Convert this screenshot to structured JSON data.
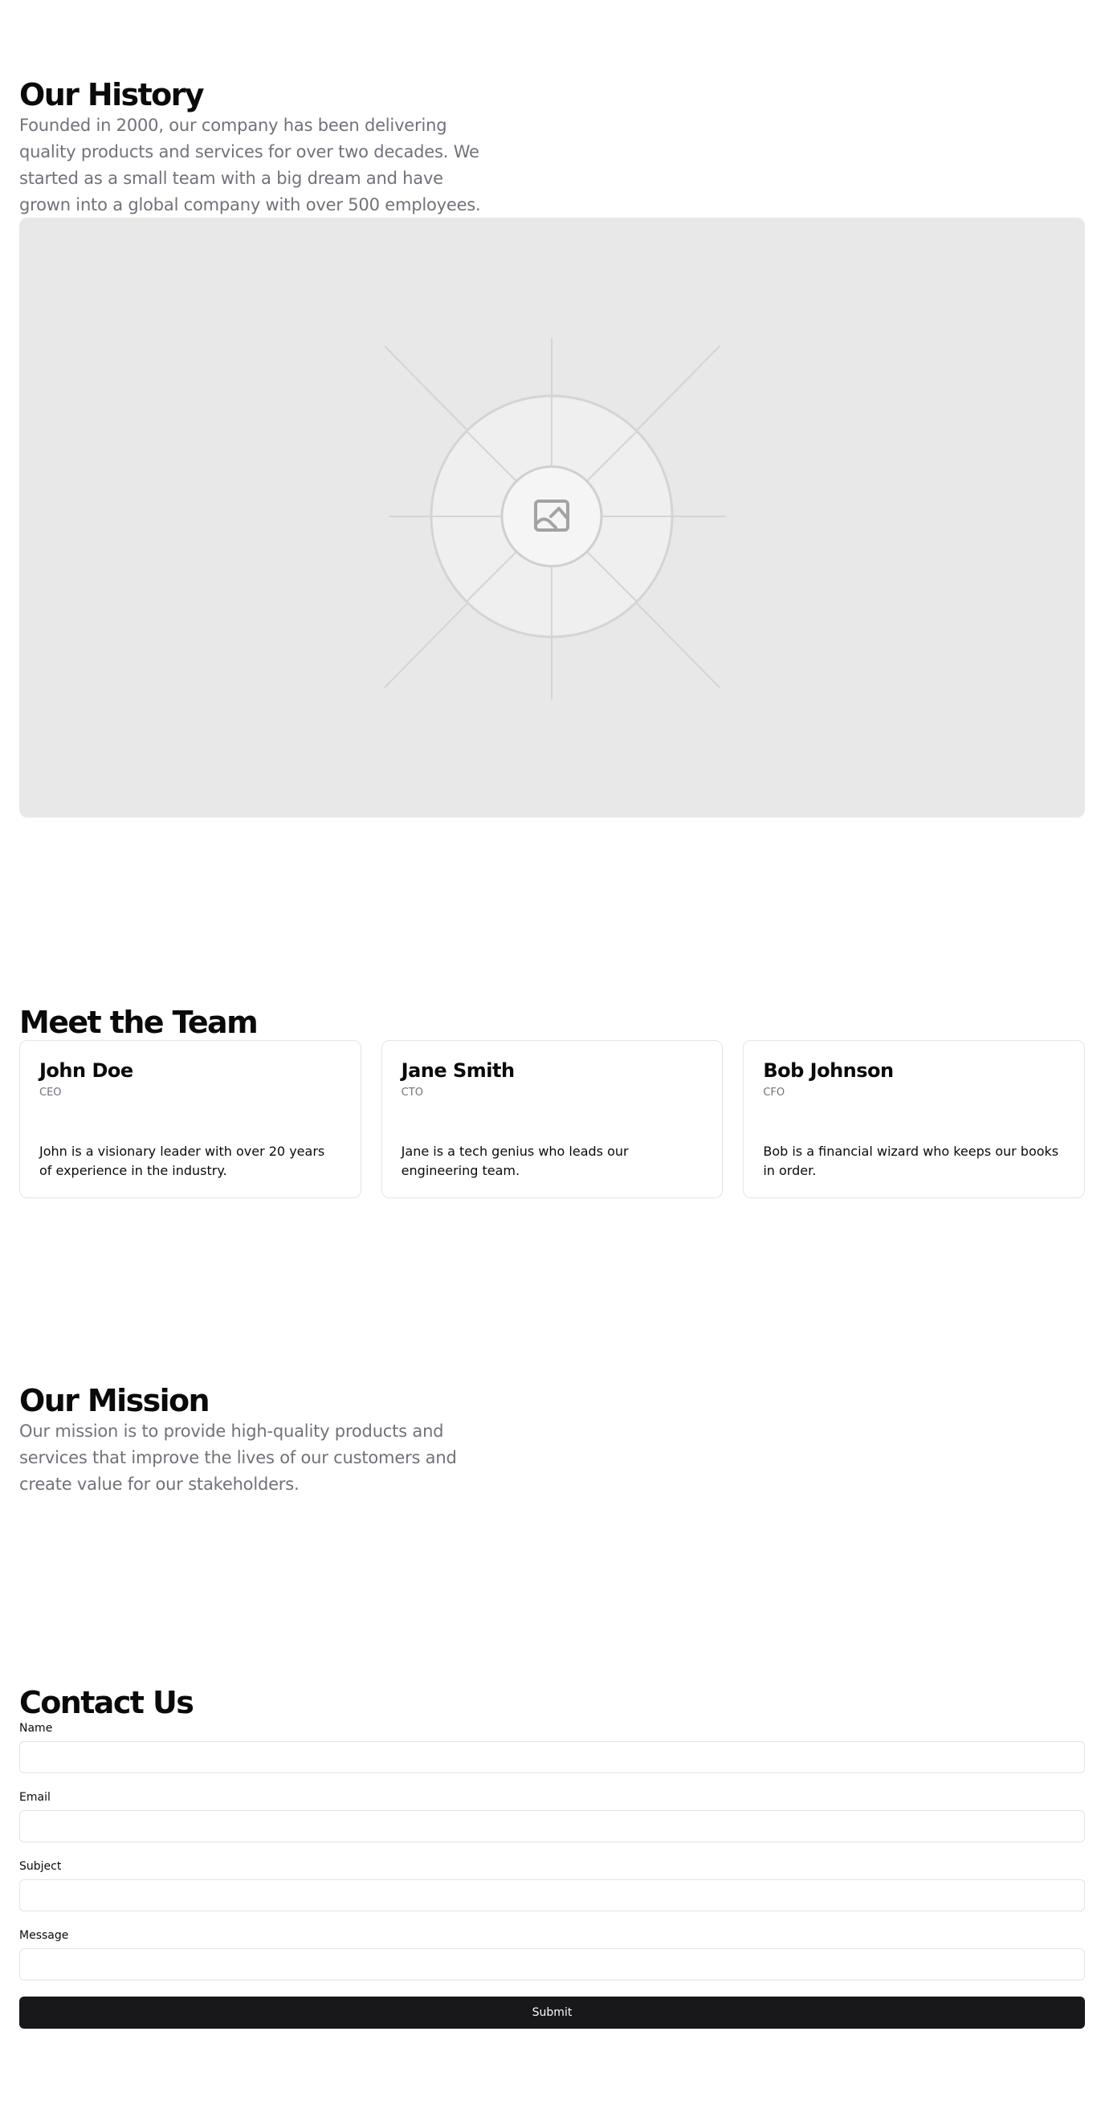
{
  "history": {
    "title": "Our History",
    "text": "Founded in 2000, our company has been delivering quality products and services for over two decades. We started as a small team with a big dream and have grown into a global company with over 500 employees.",
    "image_icon": "image-icon"
  },
  "team": {
    "title": "Meet the Team",
    "members": [
      {
        "name": "John Doe",
        "role": "CEO",
        "bio": "John is a visionary leader with over 20 years of experience in the industry."
      },
      {
        "name": "Jane Smith",
        "role": "CTO",
        "bio": "Jane is a tech genius who leads our engineering team."
      },
      {
        "name": "Bob Johnson",
        "role": "CFO",
        "bio": "Bob is a financial wizard who keeps our books in order."
      }
    ]
  },
  "mission": {
    "title": "Our Mission",
    "text": "Our mission is to provide high-quality products and services that improve the lives of our customers and create value for our stakeholders."
  },
  "contact": {
    "title": "Contact Us",
    "fields": [
      {
        "label": "Name",
        "value": ""
      },
      {
        "label": "Email",
        "value": ""
      },
      {
        "label": "Subject",
        "value": ""
      },
      {
        "label": "Message",
        "value": ""
      }
    ],
    "submit_label": "Submit"
  },
  "colors": {
    "background": "#ffffff",
    "text": "#0a0a0a",
    "muted": "#71717a",
    "border": "#e4e4e7",
    "placeholder_bg": "#e8e8e8",
    "button_bg": "#18181b",
    "button_text": "#fafafa"
  }
}
